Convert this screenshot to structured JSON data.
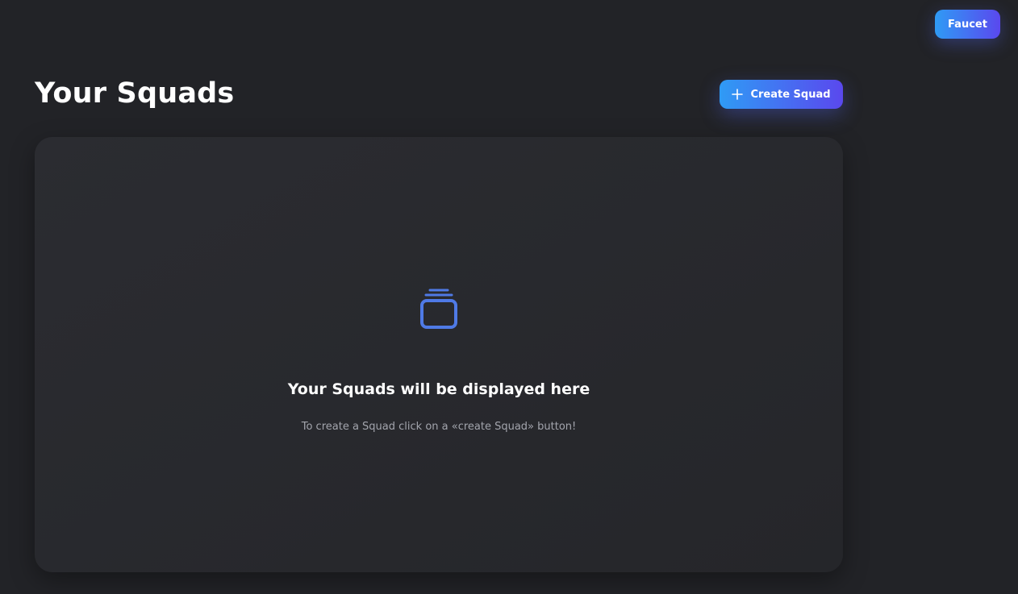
{
  "header": {
    "faucet_label": "Faucet"
  },
  "main": {
    "title": "Your Squads",
    "create_label": "Create Squad",
    "empty_state": {
      "icon": "stack-icon",
      "title": "Your Squads will be displayed here",
      "subtitle": "To create a Squad click on a «create Squad» button!"
    }
  },
  "colors": {
    "background": "#222327",
    "panel": "#2a2b30",
    "accent_start": "#2f9bf5",
    "accent_end": "#5a48ee",
    "icon": "#4f7ae6",
    "muted_text": "#a3a5ad"
  }
}
